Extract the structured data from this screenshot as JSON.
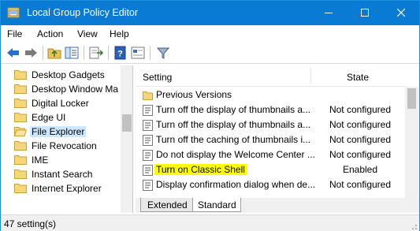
{
  "window": {
    "title": "Local Group Policy Editor"
  },
  "menu": [
    "File",
    "Action",
    "View",
    "Help"
  ],
  "toolbar": {
    "icons": [
      "back-arrow-icon",
      "forward-arrow-icon",
      "up-folder-icon",
      "show-hide-tree-icon",
      "export-list-icon",
      "help-icon",
      "properties-icon",
      "filter-icon"
    ]
  },
  "tree": {
    "items": [
      {
        "label": "Desktop Gadgets",
        "selected": false
      },
      {
        "label": "Desktop Window Ma",
        "selected": false
      },
      {
        "label": "Digital Locker",
        "selected": false
      },
      {
        "label": "Edge UI",
        "selected": false
      },
      {
        "label": "File Explorer",
        "selected": true
      },
      {
        "label": "File Revocation",
        "selected": false
      },
      {
        "label": "IME",
        "selected": false
      },
      {
        "label": "Instant Search",
        "selected": false
      },
      {
        "label": "Internet Explorer",
        "selected": false
      }
    ]
  },
  "list": {
    "columns": {
      "setting": "Setting",
      "state": "State"
    },
    "rows": [
      {
        "type": "folder",
        "setting": "Previous Versions",
        "state": ""
      },
      {
        "type": "policy",
        "setting": "Turn off the display of thumbnails a...",
        "state": "Not configured"
      },
      {
        "type": "policy",
        "setting": "Turn off the display of thumbnails a...",
        "state": "Not configured"
      },
      {
        "type": "policy",
        "setting": "Turn off the caching of thumbnails i...",
        "state": "Not configured"
      },
      {
        "type": "policy",
        "setting": "Do not display the Welcome Center ...",
        "state": "Not configured"
      },
      {
        "type": "policy",
        "setting": "Turn on Classic Shell",
        "state": "Enabled",
        "highlight": true
      },
      {
        "type": "policy",
        "setting": "Display confirmation dialog when de...",
        "state": "Not configured"
      }
    ]
  },
  "tabs": [
    "Extended",
    "Standard"
  ],
  "status": {
    "text": "47 setting(s)"
  },
  "colors": {
    "titlebar": "#0a7bd4",
    "highlight": "#ffff00",
    "selection": "#cce8ff"
  }
}
